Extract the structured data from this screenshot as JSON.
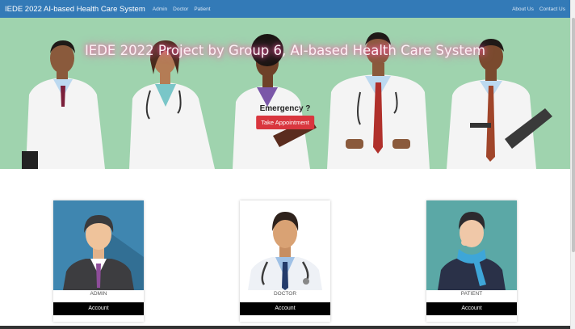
{
  "navbar": {
    "brand": "IEDE 2022 AI-based Health Care System",
    "links": [
      "Admin",
      "Doctor",
      "Patient"
    ],
    "right_links": [
      "About Us",
      "Contact Us"
    ],
    "color": "#337ab7"
  },
  "hero": {
    "title": "IEDE 2022 Project by Group 6, AI-based Health Care System",
    "emergency": "Emergency ?",
    "button": "Take Appointment",
    "background": "#9fd3ae",
    "button_color": "#d9363e"
  },
  "cards": [
    {
      "role": "ADMIN",
      "button": "Account",
      "icon": "admin-avatar"
    },
    {
      "role": "DOCTOR",
      "button": "Account",
      "icon": "doctor-avatar"
    },
    {
      "role": "PATIENT",
      "button": "Account",
      "icon": "patient-avatar"
    }
  ]
}
